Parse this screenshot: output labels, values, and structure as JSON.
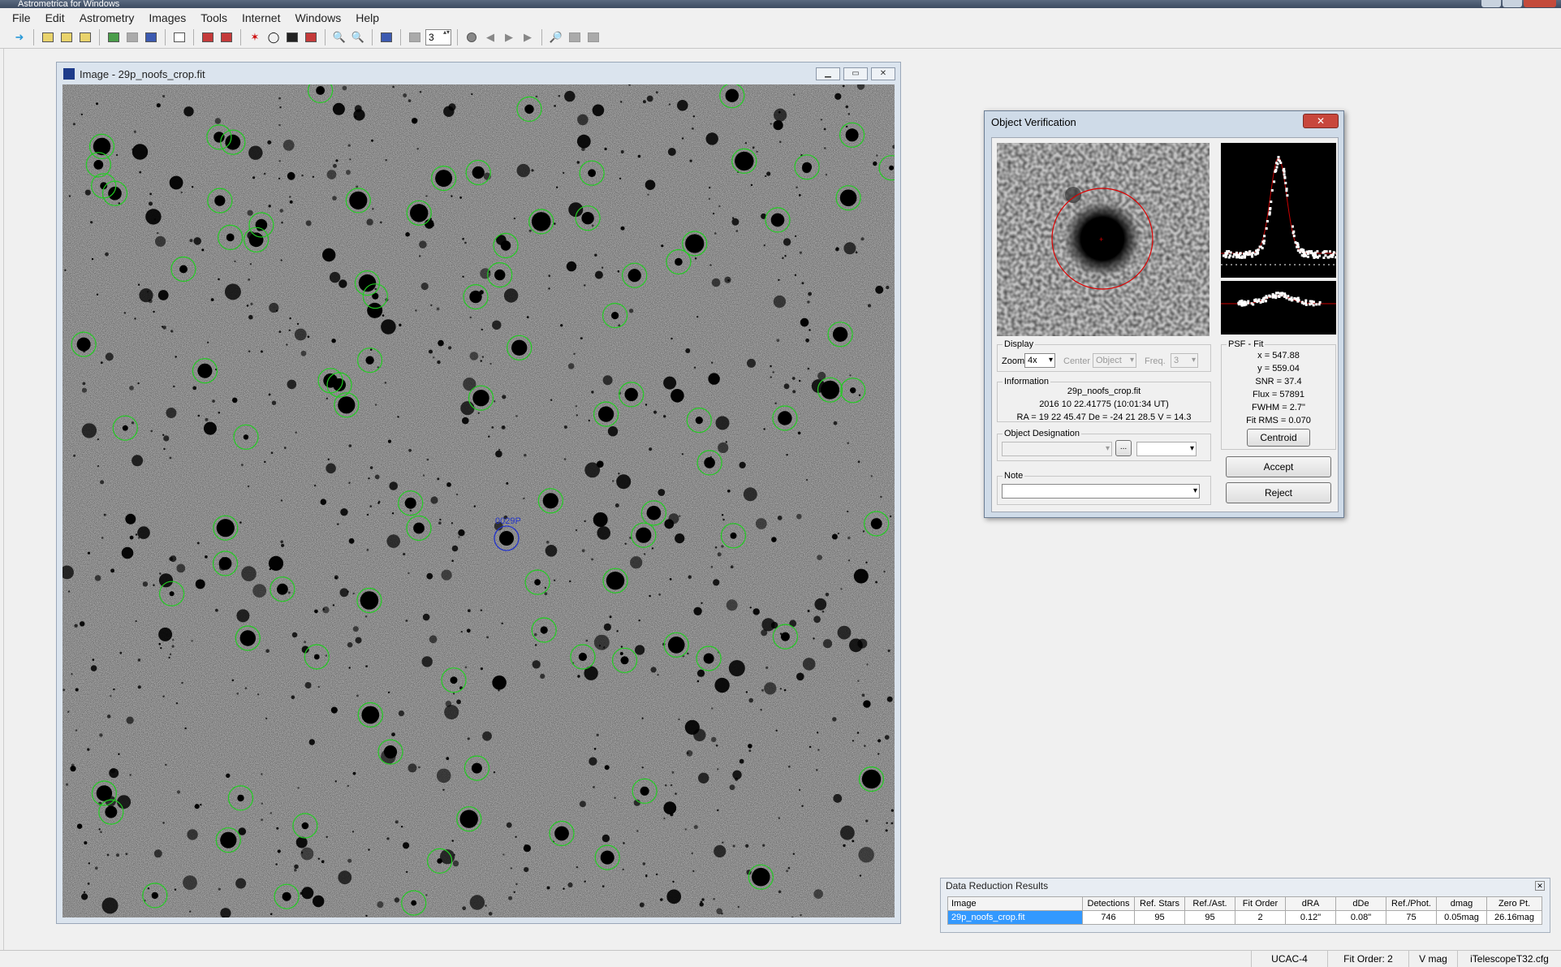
{
  "app": {
    "title": "Astrometrica for Windows"
  },
  "menu": [
    "File",
    "Edit",
    "Astrometry",
    "Images",
    "Tools",
    "Internet",
    "Windows",
    "Help"
  ],
  "toolbar": {
    "spin_value": "3"
  },
  "image_window": {
    "title": "Image - 29p_noofs_crop.fit",
    "target_label": "0029P"
  },
  "object_verification": {
    "title": "Object Verification",
    "display": {
      "legend": "Display",
      "zoom_label": "Zoom",
      "zoom_value": "4x",
      "center_label": "Center",
      "center_value": "Object",
      "freq_label": "Freq.",
      "freq_value": "3"
    },
    "information": {
      "legend": "Information",
      "file": "29p_noofs_crop.fit",
      "date": "2016 10 22.41775 (10:01:34 UT)",
      "coords": "RA = 19 22 45.47   De = -24 21 28.5   V = 14.3"
    },
    "designation": {
      "legend": "Object Designation",
      "browse": "..."
    },
    "note": {
      "legend": "Note"
    },
    "psf": {
      "legend": "PSF - Fit",
      "x": "x = 547.88",
      "y": "y = 559.04",
      "snr": "SNR = 37.4",
      "flux": "Flux = 57891",
      "fwhm": "FWHM = 2.7\"",
      "rms": "Fit RMS = 0.070"
    },
    "centroid_button": "Centroid",
    "accept_button": "Accept",
    "reject_button": "Reject"
  },
  "data_reduction": {
    "title": "Data Reduction Results",
    "columns": [
      "Image",
      "Detections",
      "Ref. Stars",
      "Ref./Ast.",
      "Fit Order",
      "dRA",
      "dDe",
      "Ref./Phot.",
      "dmag",
      "Zero Pt."
    ],
    "rows": [
      [
        "29p_noofs_crop.fit",
        "746",
        "95",
        "95",
        "2",
        "0.12\"",
        "0.08\"",
        "75",
        "0.05mag",
        "26.16mag"
      ]
    ]
  },
  "statusbar": [
    "UCAC-4",
    "Fit Order: 2",
    "V mag",
    "iTelescopeT32.cfg"
  ],
  "colors": {
    "detection_circle": "#22cc22",
    "target_circle": "#2233cc",
    "psf_fit": "#cc0000"
  }
}
